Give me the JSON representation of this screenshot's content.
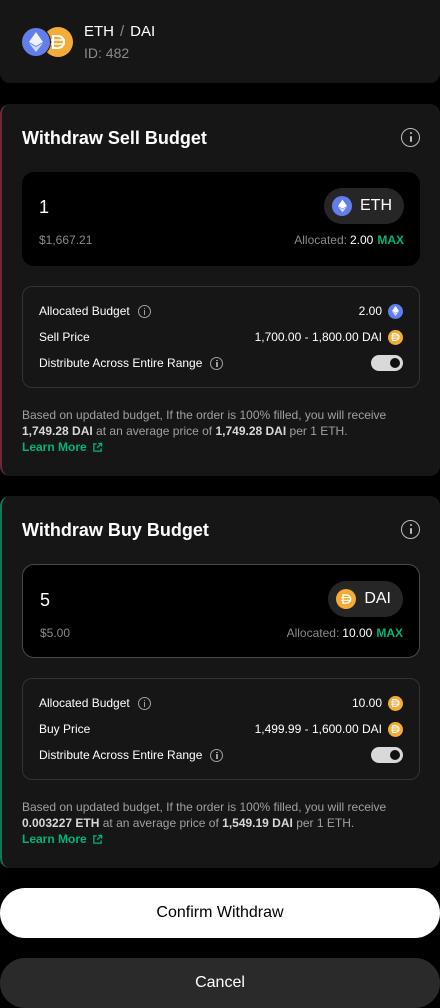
{
  "header": {
    "base_token": "ETH",
    "separator": "/",
    "quote_token": "DAI",
    "strategy_id": "ID: 482"
  },
  "sell": {
    "title": "Withdraw Sell Budget",
    "amount": "1",
    "token": "ETH",
    "usd_value": "$1,667.21",
    "allocated_label": "Allocated:",
    "allocated_value": "2.00",
    "max_label": "MAX",
    "rows": {
      "allocated_budget_label": "Allocated Budget",
      "allocated_budget_value": "2.00",
      "price_label": "Sell Price",
      "price_value": "1,700.00 - 1,800.00 DAI",
      "distribute_label": "Distribute Across Entire Range",
      "distribute_on": true
    },
    "note": {
      "p1": "Based on updated budget, If the order is 100% filled, you will receive ",
      "b1": "1,749.28 DAI",
      "p2": " at an average price of ",
      "b2": "1,749.28 DAI",
      "p3": " per 1 ETH."
    },
    "learn_more": "Learn More"
  },
  "buy": {
    "title": "Withdraw Buy Budget",
    "amount": "5",
    "token": "DAI",
    "usd_value": "$5.00",
    "allocated_label": "Allocated:",
    "allocated_value": "10.00",
    "max_label": "MAX",
    "rows": {
      "allocated_budget_label": "Allocated Budget",
      "allocated_budget_value": "10.00",
      "price_label": "Buy Price",
      "price_value": "1,499.99 - 1,600.00 DAI",
      "distribute_label": "Distribute Across Entire Range",
      "distribute_on": true
    },
    "note": {
      "p1": "Based on updated budget, If the order is 100% filled, you will receive ",
      "b1": "0.003227 ETH",
      "p2": " at an average price of ",
      "b2": "1,549.19 DAI",
      "p3": " per 1 ETH."
    },
    "learn_more": "Learn More"
  },
  "actions": {
    "confirm": "Confirm Withdraw",
    "cancel": "Cancel"
  },
  "icons": {
    "eth": "ethereum-icon",
    "dai": "dai-icon",
    "info": "info-icon",
    "external": "external-link-icon"
  },
  "colors": {
    "accent_green": "#00b578",
    "eth": "#627eea",
    "dai": "#f5ac37",
    "sell_border": "#6b2a35",
    "buy_border": "#0f7a55"
  }
}
